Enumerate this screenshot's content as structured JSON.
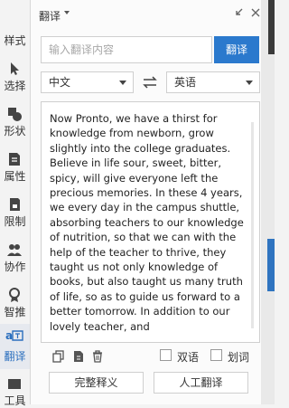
{
  "sidebar": {
    "items": [
      {
        "label": "样式",
        "icon": "style-icon"
      },
      {
        "label": "选择",
        "icon": "select-arrow-icon"
      },
      {
        "label": "形状",
        "icon": "shapes-icon"
      },
      {
        "label": "属性",
        "icon": "properties-icon"
      },
      {
        "label": "限制",
        "icon": "restrict-icon"
      },
      {
        "label": "协作",
        "icon": "collaborate-icon"
      },
      {
        "label": "智推",
        "icon": "smart-push-icon"
      },
      {
        "label": "翻译",
        "icon": "translate-icon"
      },
      {
        "label": "工具",
        "icon": "tools-icon"
      }
    ],
    "active_index": 7
  },
  "header": {
    "title": "翻译"
  },
  "search": {
    "placeholder": "输入翻译内容",
    "value": "",
    "button_label": "翻译"
  },
  "languages": {
    "source": "中文",
    "target": "英语"
  },
  "result": {
    "text": "Now Pronto, we have a thirst for knowledge from newborn, grow slightly into the college graduates. Believe in life sour, sweet, bitter, spicy, will give everyone left the precious memories. In these 4 years, we every day in the campus shuttle, absorbing teachers to our knowledge of nutrition, so that we can with the help of the teacher to thrive, they taught us not only knowledge of books, but also taught us many truth of life, so as to guide us forward to a better tomorrow. In addition to our lovely teacher, and"
  },
  "options": {
    "bilingual_label": "双语",
    "word_label": "划词"
  },
  "buttons": {
    "full_label": "完整释义",
    "human_label": "人工翻译"
  },
  "colors": {
    "accent": "#2b79cd",
    "active_label": "#2b6fbe"
  }
}
